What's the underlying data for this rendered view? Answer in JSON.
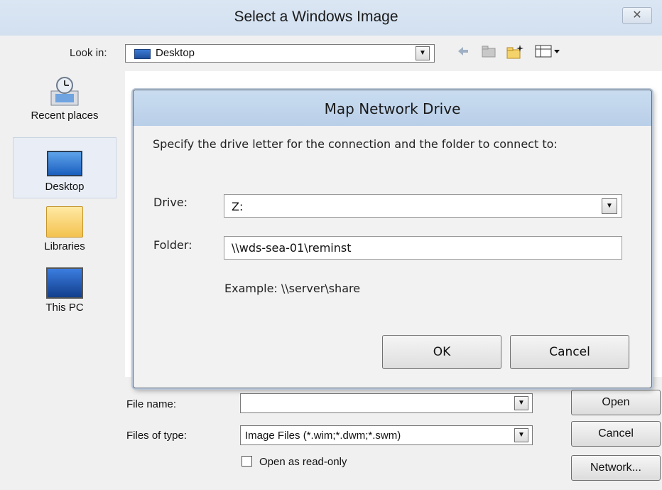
{
  "outer_dialog": {
    "title": "Select a Windows Image",
    "close_glyph": "✕",
    "look_in_label": "Look in:",
    "look_in_value": "Desktop",
    "toolbar_icons": [
      "back-arrow-icon",
      "up-folder-icon",
      "new-folder-icon",
      "view-menu-icon"
    ],
    "places": [
      {
        "label": "Recent places",
        "icon": "recent-places-icon"
      },
      {
        "label": "Desktop",
        "icon": "desktop-icon",
        "selected": true
      },
      {
        "label": "Libraries",
        "icon": "libraries-icon"
      },
      {
        "label": "This PC",
        "icon": "this-pc-icon"
      }
    ],
    "file_name_label": "File name:",
    "file_name_value": "",
    "files_of_type_label": "Files of type:",
    "files_of_type_value": "Image Files (*.wim;*.dwm;*.swm)",
    "read_only_label": "Open as read-only",
    "open_button": "Open",
    "cancel_button": "Cancel",
    "network_button": "Network..."
  },
  "map_drive_dialog": {
    "title": "Map Network Drive",
    "instruction": "Specify the drive letter for the connection and the folder to connect to:",
    "drive_label": "Drive:",
    "drive_value": "Z:",
    "folder_label": "Folder:",
    "folder_value": "\\\\wds-sea-01\\reminst",
    "example": "Example: \\\\server\\share",
    "ok_button": "OK",
    "cancel_button": "Cancel"
  }
}
